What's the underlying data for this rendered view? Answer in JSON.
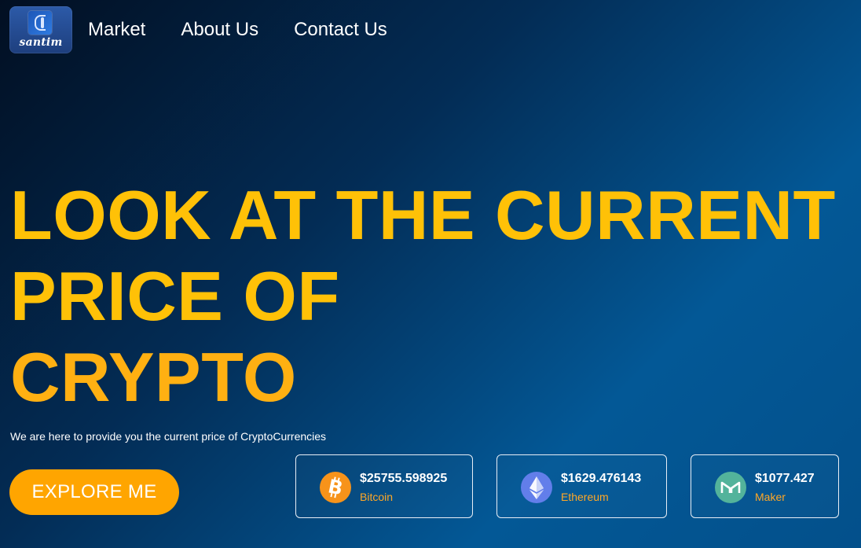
{
  "nav": {
    "logo_text": "santim",
    "links": [
      "Market",
      "About Us",
      "Contact Us"
    ]
  },
  "hero": {
    "title_line1": "LOOK AT THE CURRENT",
    "title_line2": "PRICE OF",
    "title_line3": "CRYPTO",
    "subtitle": "We are here to provide you the current price of CryptoCurrencies",
    "button_label": "EXPLORE ME"
  },
  "coins": [
    {
      "price": "$25755.598925",
      "name": "Bitcoin",
      "icon": "bitcoin-icon",
      "color": "#f7931a"
    },
    {
      "price": "$1629.476143",
      "name": "Ethereum",
      "icon": "ethereum-icon",
      "color": "#627eea"
    },
    {
      "price": "$1077.427",
      "name": "Maker",
      "icon": "maker-icon",
      "color": "#53b39b"
    }
  ],
  "colors": {
    "accent": "#ffc107",
    "button": "#ffa500",
    "coin_name": "#ffa726"
  }
}
